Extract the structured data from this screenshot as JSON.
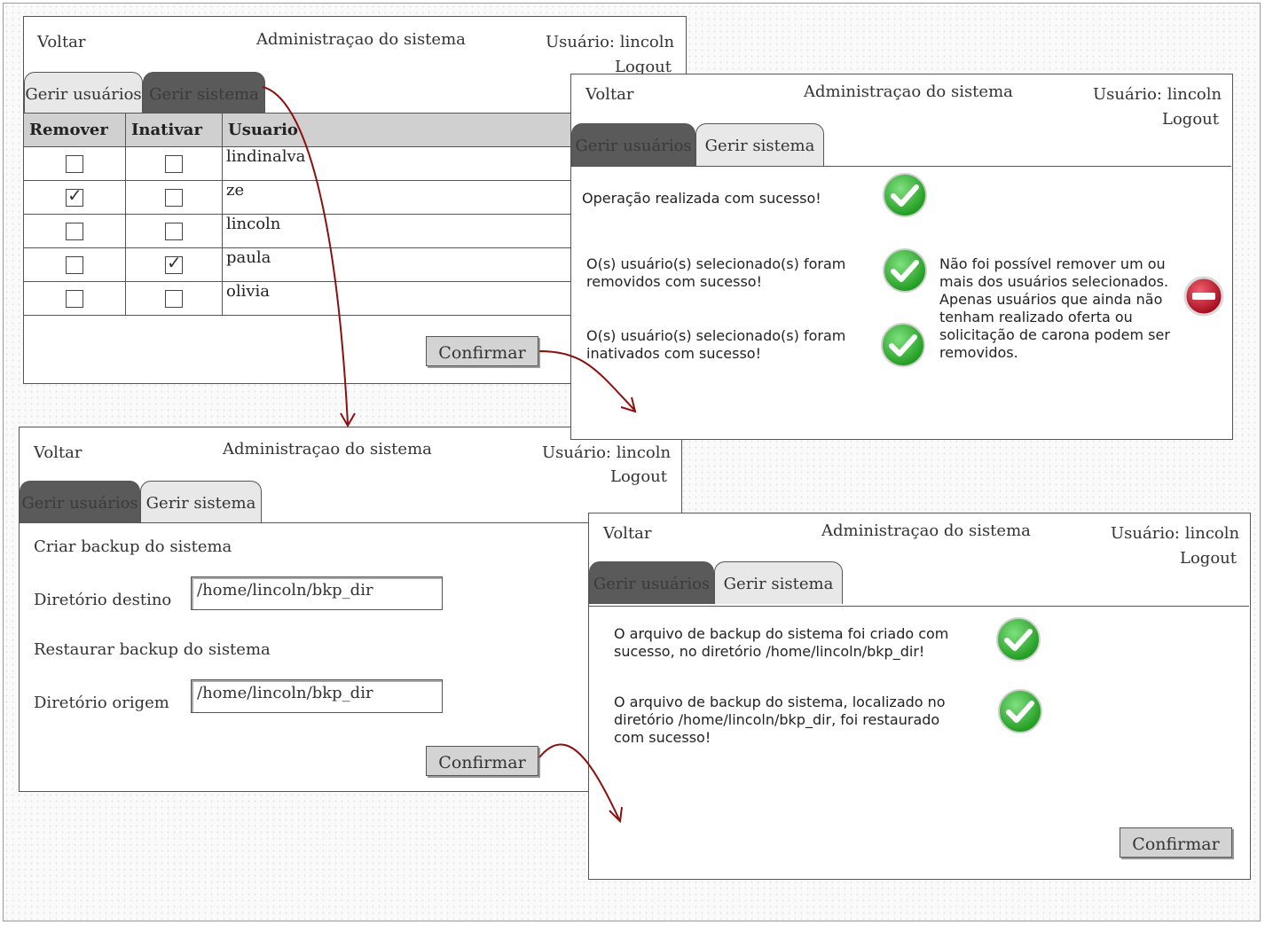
{
  "common": {
    "back_label": "Voltar",
    "title": "Administraçao do sistema",
    "user_label": "Usuário: lincoln",
    "logout_label": "Logout",
    "tab_users": "Gerir usuários",
    "tab_system": "Gerir sistema",
    "confirm_label": "Confirmar"
  },
  "screen_users": {
    "active_tab": "tab_system",
    "columns": [
      "Remover",
      "Inativar",
      "Usuario"
    ],
    "rows": [
      {
        "remove": false,
        "inactivate": false,
        "user": "lindinalva"
      },
      {
        "remove": true,
        "inactivate": false,
        "user": "ze"
      },
      {
        "remove": false,
        "inactivate": false,
        "user": "lincoln"
      },
      {
        "remove": false,
        "inactivate": true,
        "user": "paula"
      },
      {
        "remove": false,
        "inactivate": false,
        "user": "olivia"
      }
    ]
  },
  "screen_users_result": {
    "msg_success": "Operação realizada com sucesso!",
    "msg_removed_1": "O(s) usuário(s) selecionado(s) foram",
    "msg_removed_2": "removidos com sucesso!",
    "msg_inactivated_1": "O(s) usuário(s) selecionado(s) foram",
    "msg_inactivated_2": "inativados com sucesso!",
    "error_lines": [
      "Não foi possível remover um ou",
      "mais dos usuários selecionados.",
      "Apenas usuários que ainda não",
      "tenham realizado oferta ou",
      "solicitação de carona podem ser",
      "removidos."
    ]
  },
  "screen_backup": {
    "create_heading": "Criar backup do sistema",
    "dest_label": "Diretório destino",
    "dest_value": "/home/lincoln/bkp_dir",
    "restore_heading": "Restaurar backup do sistema",
    "origin_label": "Diretório origem",
    "origin_value": "/home/lincoln/bkp_dir"
  },
  "screen_backup_result": {
    "msg_created_1": "O arquivo de backup do sistema foi criado com",
    "msg_created_2": "sucesso, no diretório /home/lincoln/bkp_dir!",
    "msg_restored_1": "O arquivo de backup do sistema, localizado no",
    "msg_restored_2": "diretório /home/lincoln/bkp_dir, foi restaurado",
    "msg_restored_3": "com sucesso!"
  },
  "colors": {
    "arrow": "#8b1010",
    "success": "#3bbf3b",
    "error": "#c8102e",
    "active_tab": "#5a5a5a",
    "inactive_tab": "#e8e8e8"
  },
  "icons": [
    "check-circle-icon",
    "minus-circle-icon",
    "arrow-icon"
  ]
}
